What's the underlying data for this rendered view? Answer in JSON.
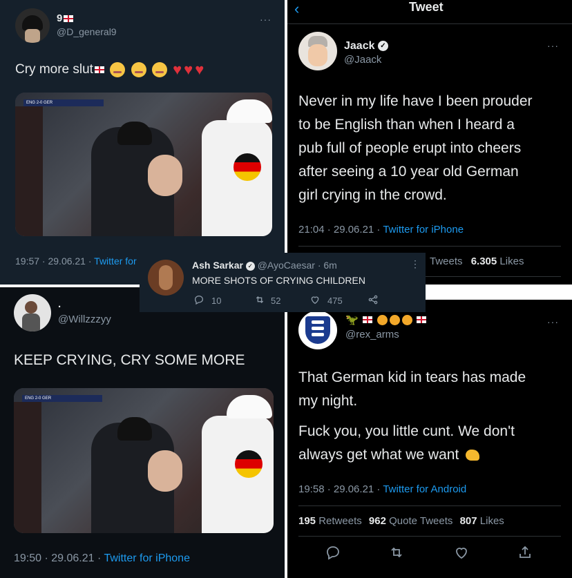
{
  "tweet1": {
    "name": "9",
    "handle": "@D_general9",
    "text": "Cry more slut",
    "timestamp": "19:57 · 29.06.21 · ",
    "source": "Twitter for"
  },
  "tweet2": {
    "header_title": "Tweet",
    "name": "Jaack",
    "handle": "@Jaack",
    "lines": [
      "Never in my life have I been prouder",
      "to be English than when I heard a",
      "pub full of people erupt into cheers",
      "after seeing a 10 year old German",
      "girl crying in the crowd."
    ],
    "timestamp": "21:04 · 29.06.21 · ",
    "source": "Twitter for iPhone",
    "stats_label": "Tweets",
    "likes_count": "6.305",
    "likes_label": "Likes"
  },
  "tweet3": {
    "name": ".",
    "handle": "@Willzzzyy",
    "text": "KEEP CRYING, CRY SOME MORE",
    "timestamp": "19:50 · 29.06.21 · ",
    "source": "Twitter for iPhone"
  },
  "tweet4": {
    "handle": "@rex_arms",
    "line1": "That German kid in tears has made",
    "line2": "my night.",
    "line3": "Fuck you, you little cunt.  We don't",
    "line4": "always get what we want",
    "timestamp": "19:58 · 29.06.21 · ",
    "source": "Twitter for Android",
    "retweets_count": "195",
    "retweets_label": "Retweets",
    "quotes_count": "962",
    "quotes_label": "Quote Tweets",
    "likes_count": "807",
    "likes_label": "Likes"
  },
  "overlay": {
    "name": "Ash Sarkar",
    "handle": "@AyoCaesar · 6m",
    "text": "MORE SHOTS OF CRYING CHILDREN",
    "replies": "10",
    "retweets": "52",
    "likes": "475"
  },
  "scoreboard": {
    "home": "ENG",
    "score": "2-0",
    "away": "GER"
  },
  "colors": {
    "link_blue": "#1d9bf0",
    "muted": "#8b98a5",
    "dim_navy": "#15202b"
  }
}
